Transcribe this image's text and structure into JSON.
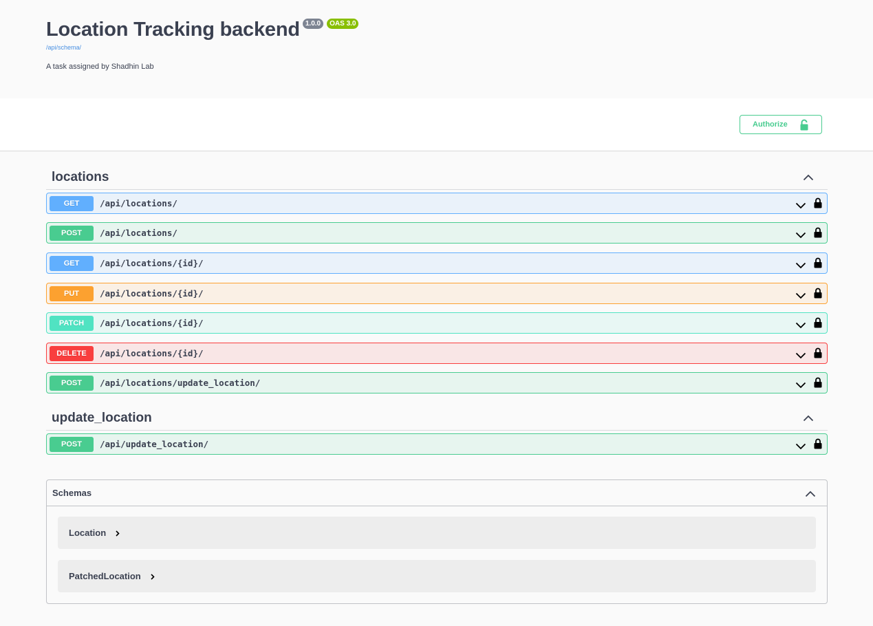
{
  "info": {
    "title": "Location Tracking backend",
    "version": "1.0.0",
    "oas": "OAS 3.0",
    "schema_link": "/api/schema/",
    "description": "A task assigned by Shadhin Lab"
  },
  "auth": {
    "label": "Authorize",
    "icon": "unlock-icon"
  },
  "colors": {
    "get": "#61affe",
    "post": "#49cc90",
    "put": "#fca130",
    "patch": "#50e3c2",
    "delete": "#f93e3e"
  },
  "tags": [
    {
      "name": "locations",
      "operations": [
        {
          "method": "GET",
          "path": "/api/locations/"
        },
        {
          "method": "POST",
          "path": "/api/locations/"
        },
        {
          "method": "GET",
          "path": "/api/locations/{id}/"
        },
        {
          "method": "PUT",
          "path": "/api/locations/{id}/"
        },
        {
          "method": "PATCH",
          "path": "/api/locations/{id}/"
        },
        {
          "method": "DELETE",
          "path": "/api/locations/{id}/"
        },
        {
          "method": "POST",
          "path": "/api/locations/update_location/"
        }
      ]
    },
    {
      "name": "update_location",
      "operations": [
        {
          "method": "POST",
          "path": "/api/update_location/"
        }
      ]
    }
  ],
  "schemas": {
    "title": "Schemas",
    "items": [
      "Location",
      "PatchedLocation"
    ]
  }
}
